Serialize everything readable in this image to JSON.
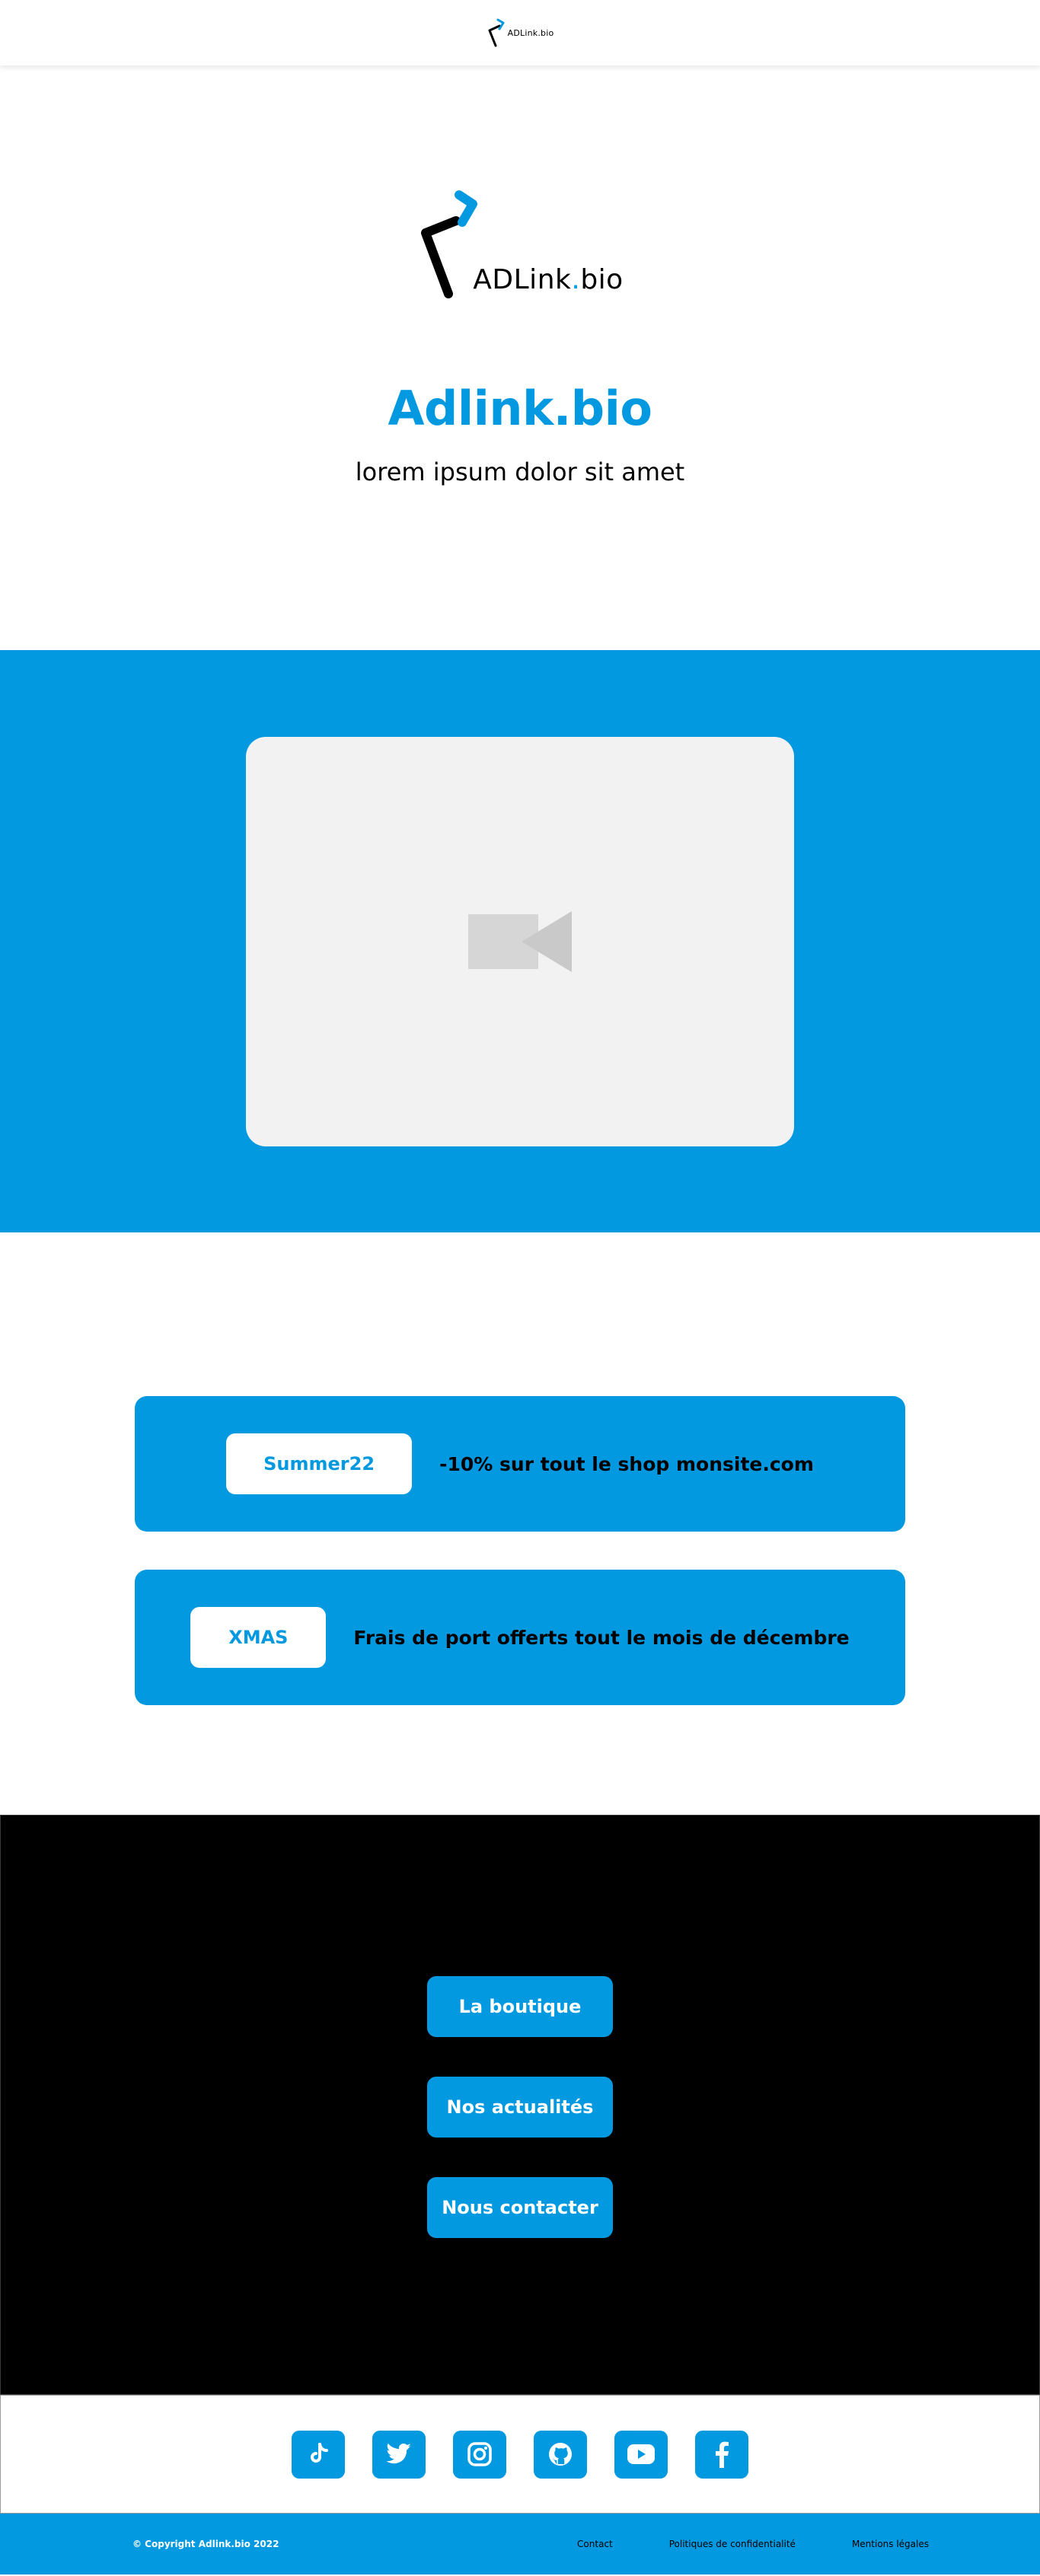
{
  "header": {
    "logo_text": "ADLink.bio"
  },
  "hero": {
    "logo_text_main": "ADLink",
    "logo_text_dot": ".",
    "logo_text_tail": "bio",
    "title": "Adlink.bio",
    "tagline": "lorem ipsum dolor sit amet"
  },
  "video": {
    "icon": "video-camera-icon"
  },
  "promos": [
    {
      "code": "Summer22",
      "description": "-10% sur tout le shop monsite.com"
    },
    {
      "code": "XMAS",
      "description": "Frais de port offerts tout le mois de décembre"
    }
  ],
  "links": [
    {
      "label": "La boutique"
    },
    {
      "label": "Nos actualités"
    },
    {
      "label": "Nous contacter"
    }
  ],
  "social": [
    "tiktok-icon",
    "twitter-icon",
    "instagram-icon",
    "github-icon",
    "youtube-icon",
    "facebook-icon"
  ],
  "footer": {
    "copyright": "© Copyright Adlink.bio 2022",
    "links": [
      "Contact",
      "Politiques de confidentialité",
      "Mentions légales"
    ]
  },
  "colors": {
    "accent": "#0299e0",
    "dark": "#000000",
    "placeholder": "#f2f2f2"
  }
}
